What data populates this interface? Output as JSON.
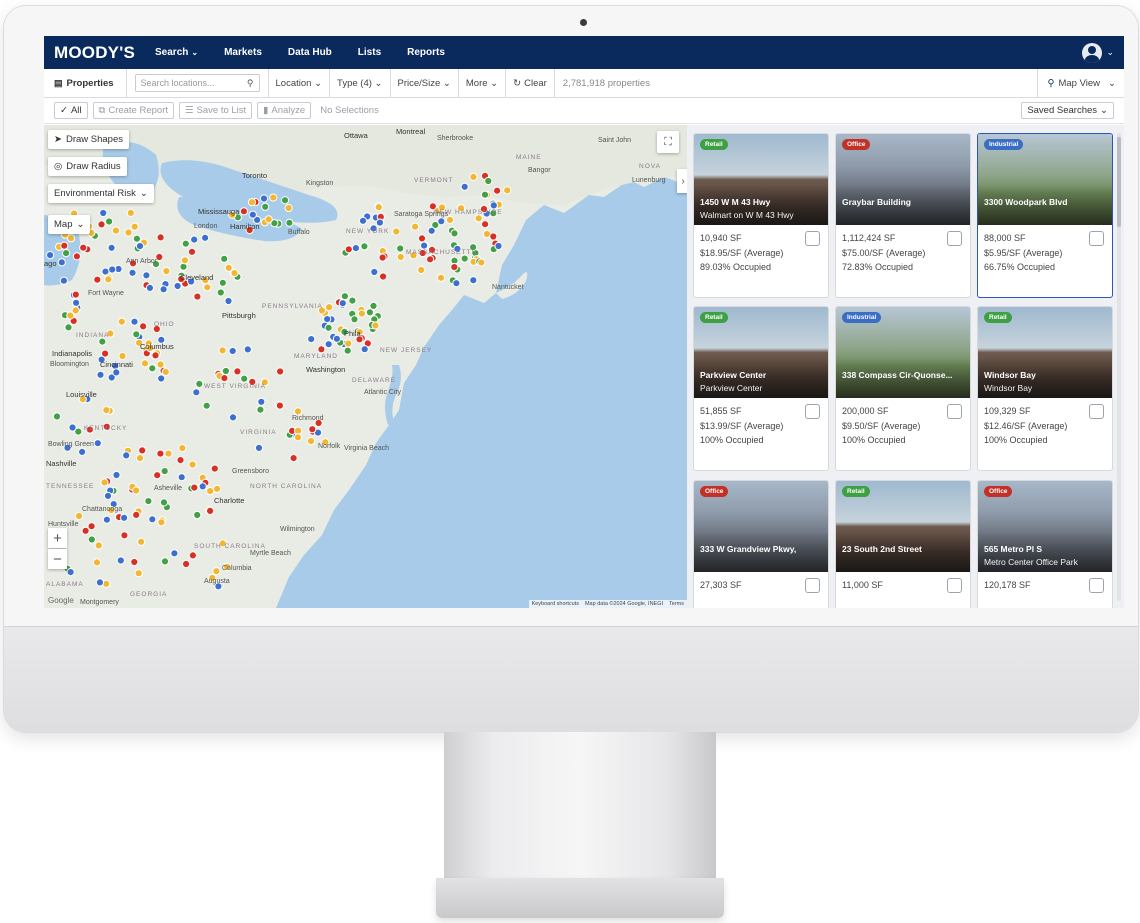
{
  "app": {
    "logo": "MOODY'S",
    "nav": [
      {
        "label": "Search",
        "caret": "⌄"
      },
      {
        "label": "Markets"
      },
      {
        "label": "Data Hub"
      },
      {
        "label": "Lists"
      },
      {
        "label": "Reports"
      }
    ]
  },
  "filterbar": {
    "properties_label": "Properties",
    "search_placeholder": "Search locations...",
    "filters": [
      "Location ⌄",
      "Type (4) ⌄",
      "Price/Size ⌄",
      "More ⌄"
    ],
    "clear_label": "Clear",
    "count": "2,781,918 properties",
    "view_label": "Map View"
  },
  "actionbar": {
    "all_label": "All",
    "create_report": "Create Report",
    "save_to_list": "Save to List",
    "analyze": "Analyze",
    "no_selections": "No Selections",
    "saved_searches": "Saved Searches"
  },
  "map": {
    "draw_shapes": "Draw Shapes",
    "draw_radius": "Draw Radius",
    "environmental_risk": "Environmental Risk",
    "map_type": "Map",
    "zoom_in": "+",
    "zoom_out": "−",
    "attribution_shortcuts": "Keyboard shortcuts",
    "attribution_data": "Map data ©2024 Google, INEGI",
    "attribution_terms": "Terms",
    "google_logo": "Google",
    "labels": {
      "ottawa": "Ottawa",
      "montreal": "Montreal",
      "sherbrooke": "Sherbrooke",
      "saint_john": "Saint John",
      "maine": "MAINE",
      "nova": "NOVA",
      "bangor": "Bangor",
      "lunenburg": "Lunenburg",
      "vermont": "VERMONT",
      "toronto": "Toronto",
      "mississauga": "Mississauga",
      "kingston": "Kingston",
      "london": "London",
      "hamilton": "Hamilton",
      "buffalo": "Buffalo",
      "new_york": "NEW YORK",
      "saratoga": "Saratoga Springs",
      "new_hampshire": "NEW HAMPSHIRE",
      "massachusetts": "MASSACHUSETTS",
      "nantucket": "Nantucket",
      "ann_arbor": "Ann Arbor",
      "cleveland": "Cleveland",
      "pennsylvania": "PENNSYLVANIA",
      "pittsburgh": "Pittsburgh",
      "new_jersey": "NEW JERSEY",
      "philadelphia": "Phila",
      "fort_wayne": "Fort Wayne",
      "ohio": "OHIO",
      "indiana": "INDIANA",
      "columbus": "Columbus",
      "indianapolis": "Indianapolis",
      "bloomington": "Bloomington",
      "cincinnati": "Cincinnati",
      "maryland": "MARYLAND",
      "washington": "Washington",
      "delaware": "DELAWARE",
      "atlantic_city": "Atlantic City",
      "west_virginia": "WEST VIRGINIA",
      "louisville": "Louisville",
      "kentucky": "KENTUCKY",
      "virginia": "VIRGINIA",
      "richmond": "Richmond",
      "norfolk": "Norfolk",
      "virginia_beach": "Virginia Beach",
      "bowling_green": "Bowling Green",
      "nashville": "Nashville",
      "tennessee": "TENNESSEE",
      "greensboro": "Greensboro",
      "north_carolina": "NORTH CAROLINA",
      "charlotte": "Charlotte",
      "asheville": "Asheville",
      "chattanooga": "Chattanooga",
      "huntsville": "Huntsville",
      "south_carolina": "SOUTH CAROLINA",
      "myrtle_beach": "Myrtle Beach",
      "wilmington": "Wilmington",
      "alabama": "ALABAMA",
      "georgia": "GEORGIA",
      "montgomery": "Montgomery",
      "augusta": "Augusta",
      "columbia": "Columbia",
      "chicago": "ago"
    }
  },
  "cards": [
    {
      "badge": "Retail",
      "type": "retail",
      "title": "1450 W M 43 Hwy",
      "subtitle": "Walmart on W M 43 Hwy",
      "size": "10,940 SF",
      "price": "$18.95/SF (Average)",
      "occupancy": "89.03% Occupied",
      "selected": false
    },
    {
      "badge": "Office",
      "type": "office",
      "title": "Graybar Building",
      "subtitle": "",
      "size": "1,112,424 SF",
      "price": "$75.00/SF (Average)",
      "occupancy": "72.83% Occupied",
      "selected": false
    },
    {
      "badge": "Industrial",
      "type": "industrial",
      "title": "3300 Woodpark Blvd",
      "subtitle": "",
      "size": "88,000 SF",
      "price": "$5.95/SF (Average)",
      "occupancy": "66.75% Occupied",
      "selected": true
    },
    {
      "badge": "Retail",
      "type": "retail",
      "title": "Parkview Center",
      "subtitle": "Parkview Center",
      "size": "51,855 SF",
      "price": "$13.99/SF (Average)",
      "occupancy": "100% Occupied",
      "selected": false
    },
    {
      "badge": "Industrial",
      "type": "industrial",
      "title": "338 Compass Cir-Quonse...",
      "subtitle": "",
      "size": "200,000 SF",
      "price": "$9.50/SF (Average)",
      "occupancy": "100% Occupied",
      "selected": false
    },
    {
      "badge": "Retail",
      "type": "retail",
      "title": "Windsor Bay",
      "subtitle": "Windsor Bay",
      "size": "109,329 SF",
      "price": "$12.46/SF (Average)",
      "occupancy": "100% Occupied",
      "selected": false
    },
    {
      "badge": "Office",
      "type": "office",
      "title": "333 W Grandview Pkwy,",
      "subtitle": "",
      "size": "27,303 SF",
      "price": "",
      "occupancy": "",
      "selected": false
    },
    {
      "badge": "Retail",
      "type": "retail",
      "title": "23 South 2nd Street",
      "subtitle": "",
      "size": "11,000 SF",
      "price": "",
      "occupancy": "",
      "selected": false
    },
    {
      "badge": "Office",
      "type": "office",
      "title": "565 Metro Pl S",
      "subtitle": "Metro Center Office Park",
      "size": "120,178 SF",
      "price": "",
      "occupancy": "",
      "selected": false
    }
  ],
  "colors": {
    "nav_bg": "#0a2a5e",
    "retail": "#3f9f43",
    "office": "#c23127",
    "industrial": "#3a6ec4",
    "pin_yellow": "#f2b632",
    "pin_green": "#43a047",
    "pin_blue": "#3d6fd1",
    "pin_red": "#d93025",
    "water": "#a7cbe8",
    "land": "#e9ece4"
  }
}
